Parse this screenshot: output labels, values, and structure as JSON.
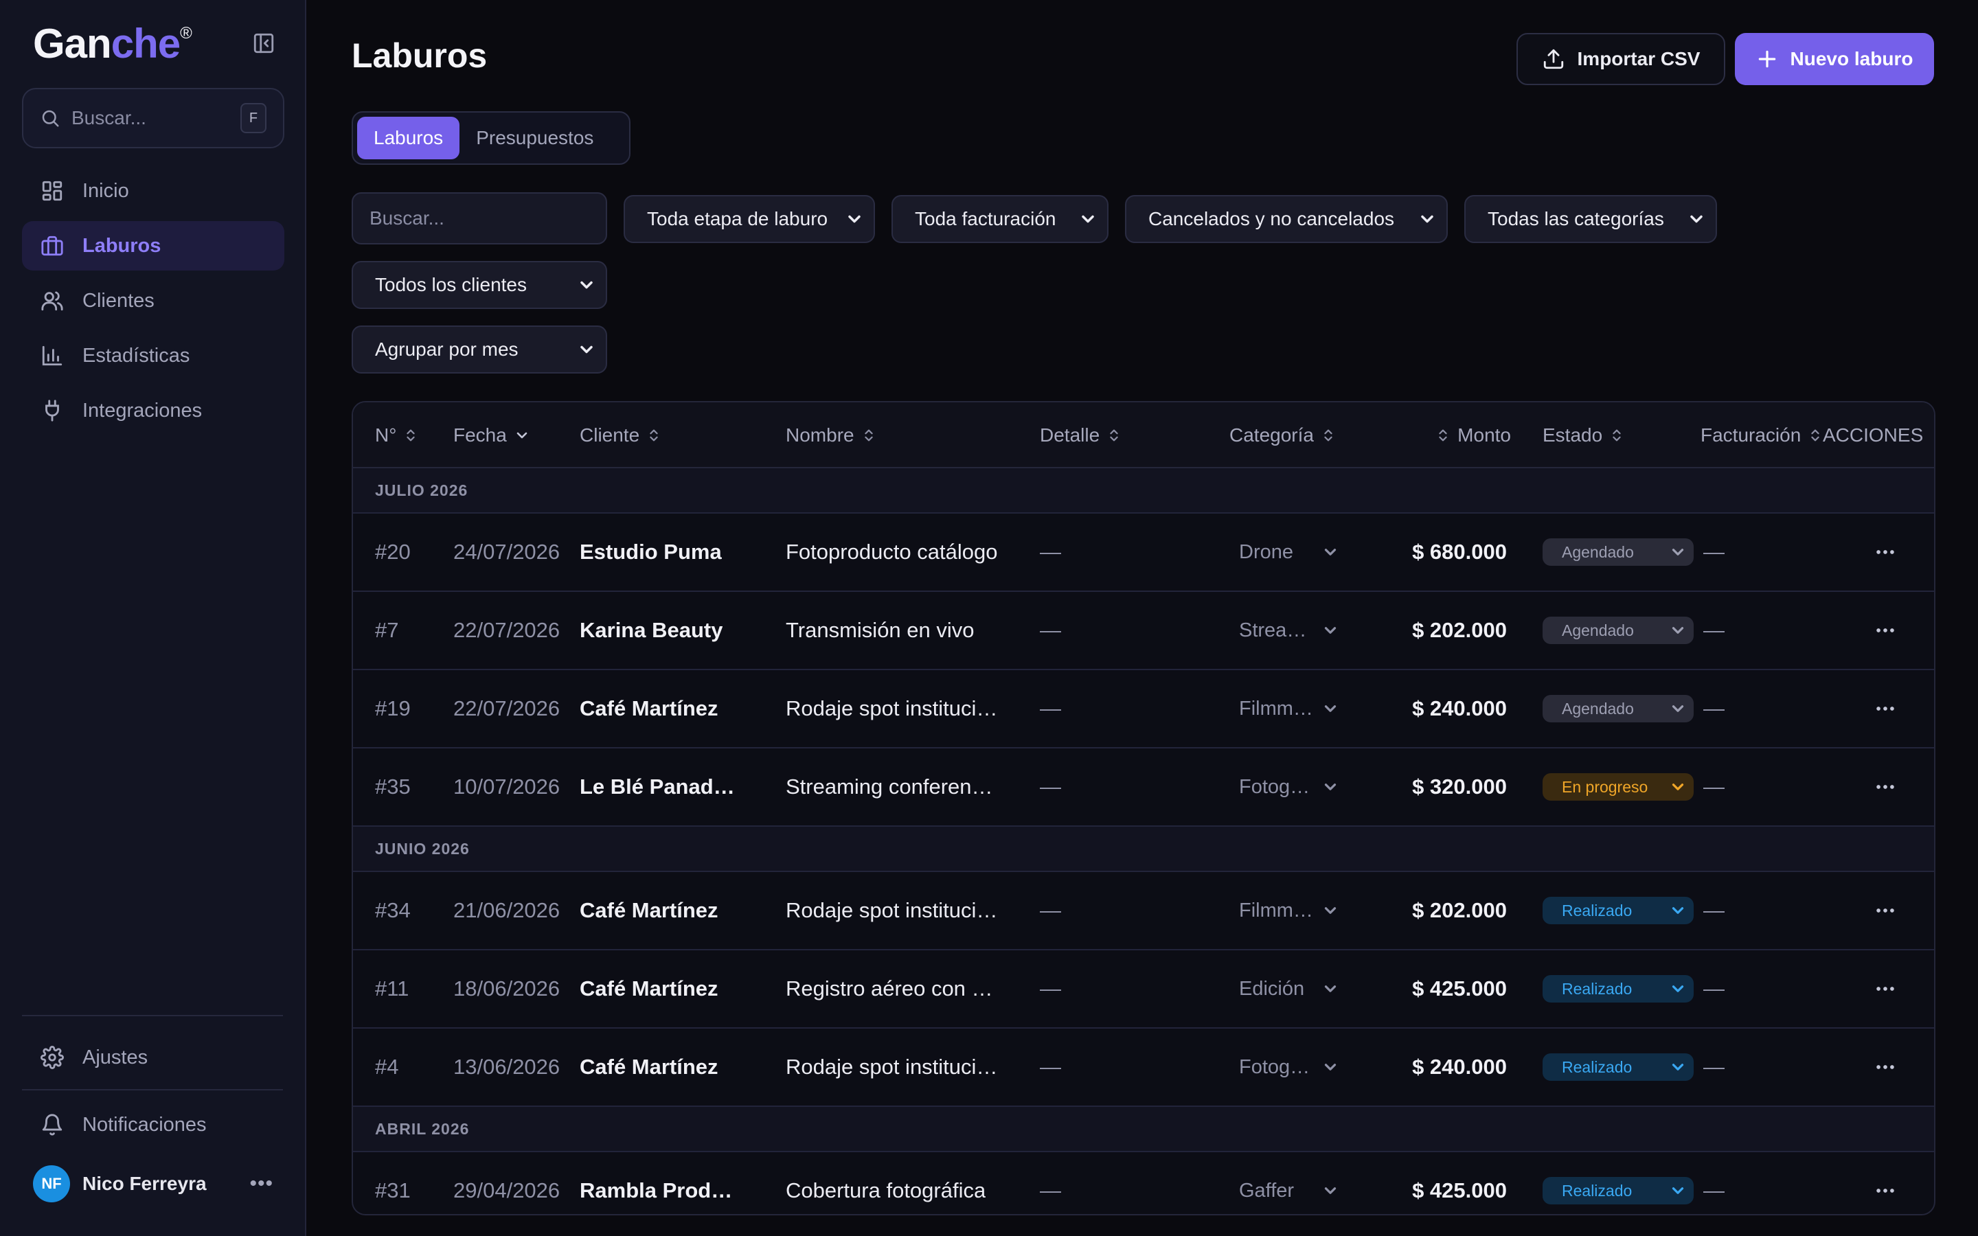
{
  "app": {
    "logo_main": "Gan",
    "logo_accent": "che",
    "logo_mark": "®"
  },
  "sidebar": {
    "search_placeholder": "Buscar...",
    "search_shortcut": "F",
    "nav": [
      {
        "label": "Inicio",
        "icon": "grid-icon"
      },
      {
        "label": "Laburos",
        "icon": "briefcase-icon",
        "active": true
      },
      {
        "label": "Clientes",
        "icon": "users-icon"
      },
      {
        "label": "Estadísticas",
        "icon": "bar-chart-icon"
      },
      {
        "label": "Integraciones",
        "icon": "plug-icon"
      }
    ],
    "settings_label": "Ajustes",
    "notifications_label": "Notificaciones",
    "user": {
      "initials": "NF",
      "name": "Nico Ferreyra"
    }
  },
  "header": {
    "title": "Laburos",
    "import_label": "Importar CSV",
    "new_label": "Nuevo laburo"
  },
  "tabs": [
    {
      "label": "Laburos",
      "active": true
    },
    {
      "label": "Presupuestos",
      "active": false
    }
  ],
  "filters": {
    "search_placeholder": "Buscar...",
    "stage": "Toda etapa de laburo",
    "billing": "Toda facturación",
    "cancel": "Cancelados y no cancelados",
    "category": "Todas las categorías",
    "clients": "Todos los clientes",
    "group": "Agrupar por mes"
  },
  "table": {
    "columns": {
      "num": "N°",
      "date": "Fecha",
      "client": "Cliente",
      "name": "Nombre",
      "detail": "Detalle",
      "category": "Categoría",
      "amount": "Monto",
      "status": "Estado",
      "billing": "Facturación",
      "actions": "ACCIONES"
    },
    "groups": [
      {
        "label": "JULIO 2026",
        "rows": [
          {
            "num": "#20",
            "date": "24/07/2026",
            "client": "Estudio Puma",
            "name": "Fotoproducto catálogo",
            "detail": "—",
            "category": "Drone",
            "amount": "$ 680.000",
            "status": "Agendado",
            "status_kind": "agendado",
            "billing": "—"
          },
          {
            "num": "#7",
            "date": "22/07/2026",
            "client": "Karina Beauty",
            "name": "Transmisión en vivo",
            "detail": "—",
            "category": "Streaming",
            "amount": "$ 202.000",
            "status": "Agendado",
            "status_kind": "agendado",
            "billing": "—"
          },
          {
            "num": "#19",
            "date": "22/07/2026",
            "client": "Café Martínez",
            "name": "Rodaje spot institucional",
            "detail": "—",
            "category": "Filmmaker",
            "amount": "$ 240.000",
            "status": "Agendado",
            "status_kind": "agendado",
            "billing": "—"
          },
          {
            "num": "#35",
            "date": "10/07/2026",
            "client": "Le Blé Panadería",
            "name": "Streaming conferencia",
            "detail": "—",
            "category": "Fotografía",
            "amount": "$ 320.000",
            "status": "En progreso",
            "status_kind": "progreso",
            "billing": "—"
          }
        ]
      },
      {
        "label": "JUNIO 2026",
        "rows": [
          {
            "num": "#34",
            "date": "21/06/2026",
            "client": "Café Martínez",
            "name": "Rodaje spot institucional",
            "detail": "—",
            "category": "Filmmaker",
            "amount": "$ 202.000",
            "status": "Realizado",
            "status_kind": "realizado",
            "billing": "—"
          },
          {
            "num": "#11",
            "date": "18/06/2026",
            "client": "Café Martínez",
            "name": "Registro aéreo con drone",
            "detail": "—",
            "category": "Edición",
            "amount": "$ 425.000",
            "status": "Realizado",
            "status_kind": "realizado",
            "billing": "—"
          },
          {
            "num": "#4",
            "date": "13/06/2026",
            "client": "Café Martínez",
            "name": "Rodaje spot institucional",
            "detail": "—",
            "category": "Fotografía",
            "amount": "$ 240.000",
            "status": "Realizado",
            "status_kind": "realizado",
            "billing": "—"
          }
        ]
      },
      {
        "label": "ABRIL 2026",
        "rows": [
          {
            "num": "#31",
            "date": "29/04/2026",
            "client": "Rambla Producciones",
            "name": "Cobertura fotográfica",
            "detail": "—",
            "category": "Gaffer",
            "amount": "$ 425.000",
            "status": "Realizado",
            "status_kind": "realizado",
            "billing": "—"
          }
        ]
      }
    ]
  },
  "colors": {
    "accent": "#7560ea",
    "status_agendado": "#9d9fb2",
    "status_progreso": "#f0a628",
    "status_realizado": "#3aa8f2"
  }
}
